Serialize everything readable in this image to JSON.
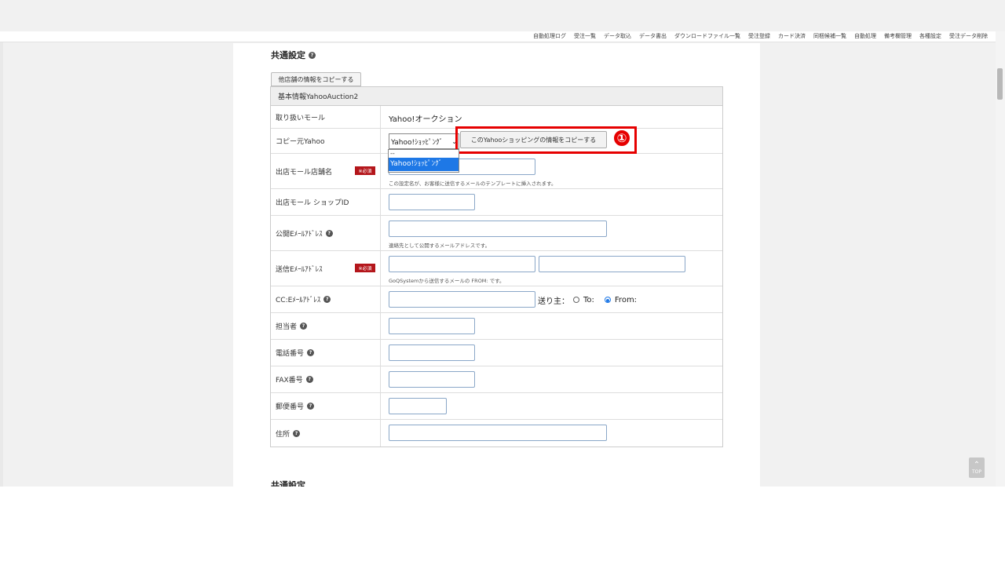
{
  "topnav": [
    "自動処理ログ",
    "受注一覧",
    "データ取込",
    "データ書出",
    "ダウンロードファイル一覧",
    "受注登録",
    "カード決済",
    "同梱候補一覧",
    "自動処理",
    "備考欄管理",
    "各種設定",
    "受注データ削除"
  ],
  "section_title": "共通設定",
  "copy_other_button": "他店舗の情報をコピーする",
  "table_head": "基本情報YahooAuction2",
  "rows": {
    "mall_label": "取り扱いモール",
    "mall_value": "Yahoo!オークション",
    "copy_src_label": "コピー元Yahoo",
    "copy_src_selected": "Yahoo!ｼｮｯﾋﾟﾝｸﾞ",
    "dropdown_options": [
      "--",
      "Yahoo!ｼｮｯﾋﾟﾝｸﾞ"
    ],
    "copy_yahoo_button": "このYahooショッピングの情報をコピーする",
    "annotation_number": "①",
    "shop_name_label": "出店モール店舗名",
    "required_badge": "※必須",
    "shop_name_note": "この設定名が、お客様に送信するメールのテンプレートに挿入されます。",
    "shop_id_label": "出店モール ショップID",
    "public_email_label": "公開Eﾒｰﾙｱﾄﾞﾚｽ",
    "public_email_note": "連絡先として公開するメールアドレスです。",
    "send_email_label": "送信Eﾒｰﾙｱﾄﾞﾚｽ",
    "send_email_note": "GoQSystemから送信するメールの FROM: です。",
    "cc_email_label": "CC:Eﾒｰﾙｱﾄﾞﾚｽ",
    "sender_label": "送り主：",
    "radio_to": "To:",
    "radio_from": "From:",
    "staff_label": "担当者",
    "phone_label": "電話番号",
    "fax_label": "FAX番号",
    "zip_label": "郵便番号",
    "address_label": "住所"
  },
  "section2_title": "共通設定",
  "top_button": "TOP",
  "colors": {
    "highlight": "#e60000",
    "selected_option": "#1e78e6",
    "required": "#b4161b"
  }
}
